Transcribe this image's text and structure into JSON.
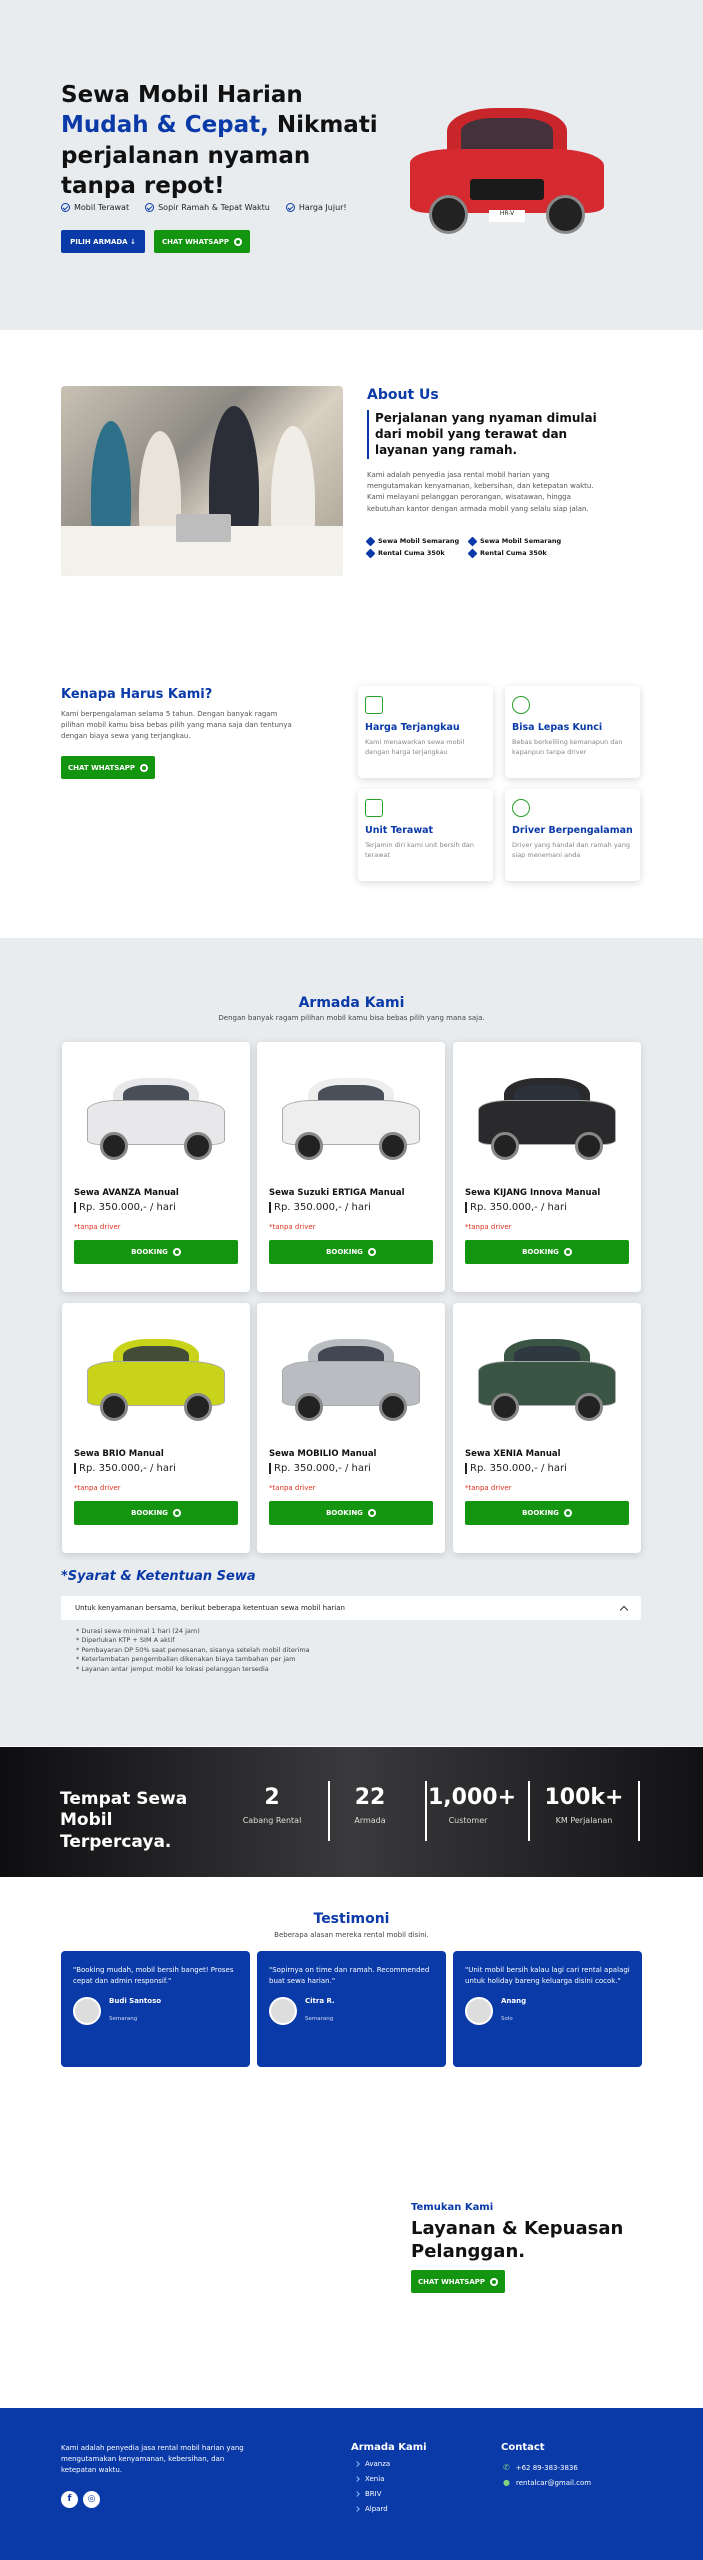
{
  "hero": {
    "title_line1": "Sewa Mobil Harian",
    "title_highlight": "Mudah & Cepat,",
    "title_rest": " Nikmati perjalanan nyaman tanpa repot!",
    "features": [
      "Mobil Terawat",
      "Sopir Ramah & Tepat Waktu",
      "Harga Jujur!"
    ],
    "btn_primary": "PILIH ARMADA ↓",
    "btn_secondary": "CHAT WHATSAPP",
    "plate": "HR-V"
  },
  "about": {
    "heading": "About Us",
    "subheading": "Perjalanan yang nyaman dimulai dari mobil yang terawat dan layanan yang ramah.",
    "body": "Kami adalah penyedia jasa rental mobil harian yang mengutamakan kenyamanan, kebersihan, dan ketepatan waktu. Kami melayani pelanggan perorangan, wisatawan, hingga kebutuhan kantor dengan armada mobil yang selalu siap jalan.",
    "points": [
      "Sewa Mobil Semarang",
      "Sewa Mobil Semarang",
      "Rental Cuma 350k",
      "Rental Cuma 350k"
    ]
  },
  "why": {
    "heading": "Kenapa Harus Kami?",
    "body": "Kami berpengalaman selama 5 tahun. Dengan banyak ragam pilihan mobil kamu bisa bebas pilih yang mana saja dan tentunya dengan biaya sewa yang terjangkau.",
    "btn": "CHAT WHATSAPP",
    "cards": [
      {
        "title": "Harga Terjangkau",
        "text": "Kami menawarkan sewa mobil dengan harga terjangkau"
      },
      {
        "title": "Bisa Lepas Kunci",
        "text": "Bebas berkeliling kemanapun dan kapanpun tanpa driver"
      },
      {
        "title": "Unit Terawat",
        "text": "Terjamin diri kami unit bersih dan terawat"
      },
      {
        "title": "Driver Berpengalaman",
        "text": "Driver yang handal dan ramah yang siap menemani anda"
      }
    ]
  },
  "fleet": {
    "heading": "Armada Kami",
    "subheading": "Dengan banyak ragam pilihan mobil kamu bisa bebas pilih yang mana saja.",
    "cars": [
      {
        "name": "Sewa AVANZA Manual",
        "price": "Rp. 350.000,- / hari",
        "note": "*tanpa driver",
        "btn": "BOOKING",
        "color": "#e8e8ea"
      },
      {
        "name": "Sewa Suzuki ERTIGA Manual",
        "price": "Rp. 350.000,- / hari",
        "note": "*tanpa driver",
        "btn": "BOOKING",
        "color": "#eeeeef"
      },
      {
        "name": "Sewa KIJANG Innova Manual",
        "price": "Rp. 350.000,- / hari",
        "note": "*tanpa driver",
        "btn": "BOOKING",
        "color": "#2a2a2c"
      },
      {
        "name": "Sewa BRIO Manual",
        "price": "Rp. 350.000,- / hari",
        "note": "*tanpa driver",
        "btn": "BOOKING",
        "color": "#c8d31a"
      },
      {
        "name": "Sewa MOBILIO Manual",
        "price": "Rp. 350.000,- / hari",
        "note": "*tanpa driver",
        "btn": "BOOKING",
        "color": "#b9bcc0"
      },
      {
        "name": "Sewa XENIA Manual",
        "price": "Rp. 350.000,- / hari",
        "note": "*tanpa driver",
        "btn": "BOOKING",
        "color": "#3a5544"
      }
    ]
  },
  "terms": {
    "heading": "*Syarat & Ketentuan Sewa",
    "accordion": "Untuk kenyamanan bersama, berikut beberapa ketentuan sewa mobil harian",
    "items": [
      "Durasi sewa minimal 1 hari (24 jam)",
      "Diperlukan KTP + SIM A aktif",
      "Pembayaran DP 50% saat pemesanan, sisanya setelah mobil diterima",
      "Keterlambatan pengembalian dikenakan biaya tambahan per jam",
      "Layanan antar jemput mobil ke lokasi pelanggan tersedia"
    ]
  },
  "stats": {
    "title": "Tempat Sewa Mobil Terpercaya.",
    "items": [
      {
        "n": "2",
        "l": "Cabang Rental"
      },
      {
        "n": "22",
        "l": "Armada"
      },
      {
        "n": "1,000+",
        "l": "Customer"
      },
      {
        "n": "100k+",
        "l": "KM Perjalanan"
      }
    ]
  },
  "testi": {
    "heading": "Testimoni",
    "subheading": "Beberapa alasan mereka rental mobil disini.",
    "items": [
      {
        "text": "\"Booking mudah, mobil bersih banget! Proses cepat dan admin responsif.\"",
        "name": "Budi Santoso",
        "city": "Semarang"
      },
      {
        "text": "\"Sopirnya on time dan ramah. Recommended buat sewa harian.\"",
        "name": "Citra R.",
        "city": "Semarang"
      },
      {
        "text": "\"Unit mobil bersih kalau lagi cari rental apalagi untuk holiday bareng keluarga disini cocok.\"",
        "name": "Anang",
        "city": "Solo"
      }
    ]
  },
  "find": {
    "kicker": "Temukan Kami",
    "title": "Layanan & Kepuasan Pelanggan.",
    "btn": "CHAT WHATSAPP"
  },
  "footer": {
    "about": "Kami adalah penyedia jasa rental mobil harian yang mengutamakan kenyamanan, kebersihan, dan ketepatan waktu.",
    "fleet_heading": "Armada Kami",
    "fleet_links": [
      "Avanza",
      "Xenia",
      "BRIV",
      "Alpard"
    ],
    "contact_heading": "Contact",
    "phone": "+62 89-383-3836",
    "email": "rentalcar@gmail.com",
    "social": [
      "f",
      "◎"
    ]
  },
  "colors": {
    "brand": "#0a3aa8",
    "whatsapp": "#13950f",
    "hero_bg": "#e9ecef"
  }
}
